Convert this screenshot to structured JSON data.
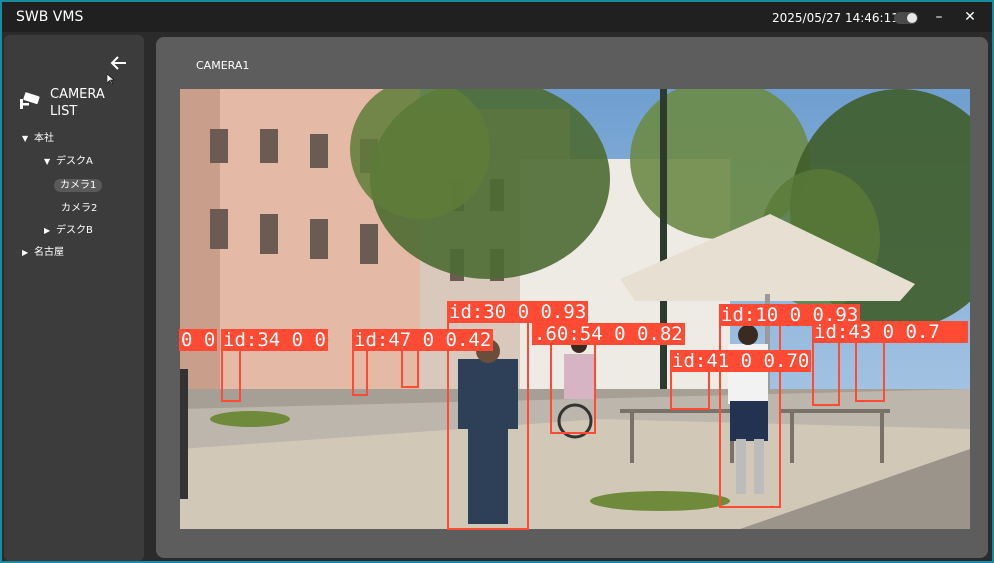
{
  "titlebar": {
    "app_title": "SWB VMS",
    "datetime": "2025/05/27 14:46:11",
    "minimize_icon": "minimize-icon",
    "close_icon": "close-icon",
    "theme_toggle_icon": "theme-toggle-icon"
  },
  "sidebar": {
    "back_icon": "arrow-left-icon",
    "camera_icon": "cctv-camera-icon",
    "title": "CAMERA LIST",
    "tree": [
      {
        "label": "本社",
        "expanded": true
      },
      {
        "label": "デスクA",
        "expanded": true
      },
      {
        "label": "カメラ1",
        "selected": true
      },
      {
        "label": "カメラ2"
      },
      {
        "label": "デスクB",
        "expanded": false
      },
      {
        "label": "名古屋",
        "expanded": false
      }
    ]
  },
  "main": {
    "camera_label": "CAMERA1"
  },
  "detections": [
    {
      "label": "0 0"
    },
    {
      "label": "id:34 0 0"
    },
    {
      "label": "id:47 0 0.42"
    },
    {
      "label": "id:30 0 0.93"
    },
    {
      "label": ".60:54 0 0.82"
    },
    {
      "label": "id:10 0 0.93"
    },
    {
      "label": "id:41 0 0.70"
    },
    {
      "label": "id:43 0 0.7"
    }
  ],
  "colors": {
    "accent_border": "#1a8a9e",
    "detection": "#ff4a34",
    "panel": "#5d5d5d",
    "sidebar": "#3c3c3c"
  }
}
